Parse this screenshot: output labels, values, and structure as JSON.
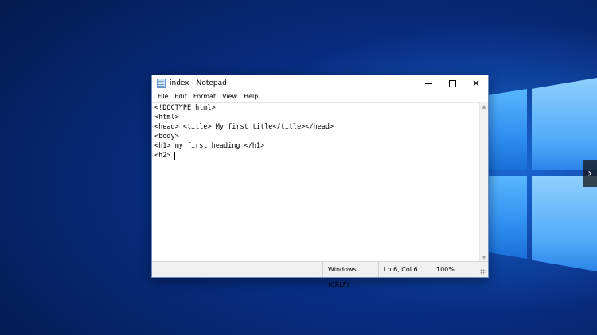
{
  "window": {
    "title": "index - Notepad",
    "controls": {
      "close_glyph": "✕"
    }
  },
  "menu": {
    "items": [
      "File",
      "Edit",
      "Format",
      "View",
      "Help"
    ]
  },
  "editor": {
    "lines": [
      "<!DOCTYPE html>",
      "<html>",
      "<head> <title> My first title</title></head>",
      "<body>",
      "<h1> my first heading </h1>",
      "<h2> "
    ]
  },
  "scrollbar": {
    "up_glyph": "▲",
    "down_glyph": "▼"
  },
  "status": {
    "encoding": "Windows (CRLF)",
    "position": "Ln 6, Col 6",
    "zoom": "100%"
  },
  "overlay": {
    "next_glyph": "›"
  },
  "colors": {
    "desktop_blue": "#0a3ea6",
    "logo_blue": "#2f8df0",
    "window_bg": "#ffffff",
    "status_bg": "#f0f0f0"
  }
}
